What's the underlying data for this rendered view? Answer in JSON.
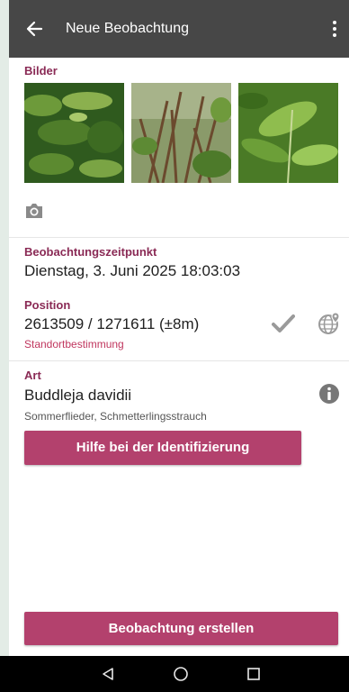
{
  "appbar": {
    "title": "Neue Beobachtung",
    "back_icon": "arrow-left-icon",
    "menu_icon": "more-vertical-icon"
  },
  "images": {
    "label": "Bilder",
    "count": 3,
    "camera_icon": "camera-icon"
  },
  "observation_time": {
    "label": "Beobachtungszeitpunkt",
    "value": "Dienstag, 3. Juni 2025 18:03:03"
  },
  "position": {
    "label": "Position",
    "value": "2613509 / 1271611 (±8m)",
    "status_link": "Standortbestimmung",
    "check_icon": "checkmark-icon",
    "map_icon": "globe-location-icon"
  },
  "species": {
    "label": "Art",
    "scientific_name": "Buddleja davidii",
    "common_names": "Sommerflieder, Schmetterlingsstrauch",
    "info_icon": "info-icon",
    "help_button": "Hilfe bei der Identifizierung"
  },
  "footer": {
    "create_button": "Beobachtung erstellen"
  },
  "system_nav": {
    "back_icon": "nav-back-triangle-icon",
    "home_icon": "nav-home-circle-icon",
    "recents_icon": "nav-recents-square-icon"
  },
  "colors": {
    "accent": "#b3416d",
    "label": "#8a2a55",
    "appbar": "#474747",
    "link": "#c0365e"
  }
}
